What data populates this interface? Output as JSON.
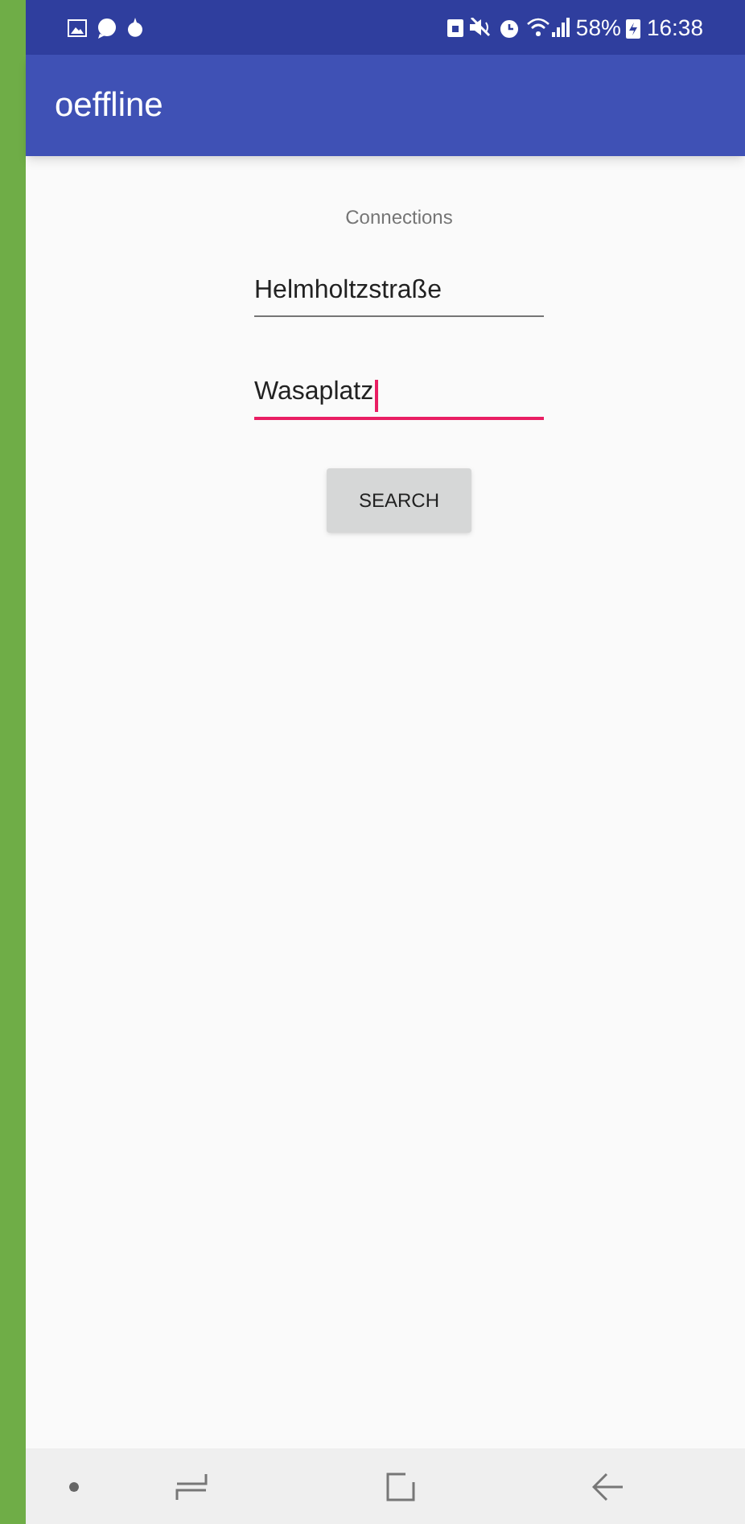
{
  "status_bar": {
    "battery": "58%",
    "time": "16:38"
  },
  "app_bar": {
    "title": "oeffline"
  },
  "heading": "Connections",
  "fields": [
    {
      "value": "Helmholtzstraße",
      "focused": false
    },
    {
      "value": "Wasaplatz",
      "focused": true
    }
  ],
  "button": "SEARCH"
}
